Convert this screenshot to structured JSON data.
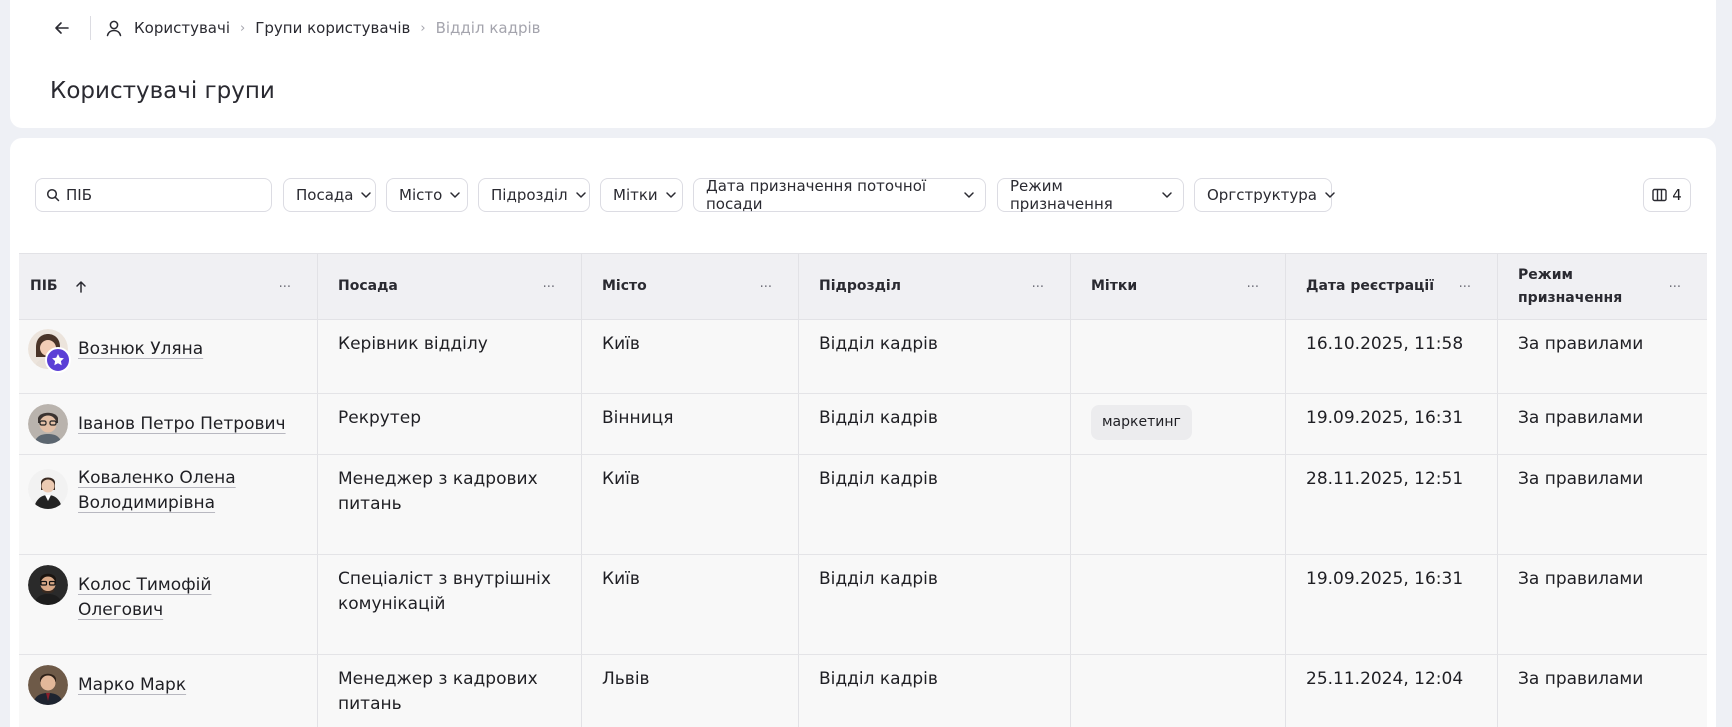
{
  "breadcrumb": {
    "items": [
      "Користувачі",
      "Групи користувачів"
    ],
    "current": "Відділ кадрів"
  },
  "page": {
    "title": "Користувачі групи"
  },
  "filters": {
    "search_placeholder": "ПІБ",
    "chips": [
      "Посада",
      "Місто",
      "Підрозділ",
      "Мітки",
      "Дата призначення поточної посади",
      "Режим призначення",
      "Оргструктура"
    ],
    "columns_count": "4"
  },
  "table": {
    "columns": [
      "ПІБ",
      "Посада",
      "Місто",
      "Підрозділ",
      "Мітки",
      "Дата реєстрації",
      "Режим призначення"
    ],
    "rows": [
      {
        "name": "Вознюк Уляна",
        "position": "Керівник відділу",
        "city": "Київ",
        "dept": "Відділ кадрів",
        "tag": "",
        "date": "16.10.2025, 11:58",
        "mode": "За правилами"
      },
      {
        "name": "Іванов Петро Петрович",
        "position": "Рекрутер",
        "city": "Вінниця",
        "dept": "Відділ кадрів",
        "tag": "маркетинг",
        "date": "19.09.2025, 16:31",
        "mode": "За правилами"
      },
      {
        "name": "Коваленко Олена Володимирівна",
        "position": "Менеджер з кадрових питань",
        "city": "Київ",
        "dept": "Відділ кадрів",
        "tag": "",
        "date": "28.11.2025, 12:51",
        "mode": "За правилами"
      },
      {
        "name": "Колос Тимофій Олегович",
        "position": "Спеціаліст з внутрішніх комунікацій",
        "city": "Київ",
        "dept": "Відділ кадрів",
        "tag": "",
        "date": "19.09.2025, 16:31",
        "mode": "За правилами"
      },
      {
        "name": "Марко Марк",
        "position": "Менеджер з кадрових питань",
        "city": "Львів",
        "dept": "Відділ кадрів",
        "tag": "",
        "date": "25.11.2024, 12:04",
        "mode": "За правилами"
      }
    ]
  },
  "colors": {
    "accent": "#5b3fd6",
    "header_bg": "#f0f0f3",
    "row_bg": "#f8f8f8"
  },
  "icons": {
    "back": "arrow-left-icon",
    "user": "user-icon",
    "search": "search-icon",
    "chevron": "chevron-down-icon",
    "columns": "columns-icon",
    "sort": "arrow-up-icon",
    "more": "more-horizontal-icon",
    "badge": "star-badge-icon"
  }
}
